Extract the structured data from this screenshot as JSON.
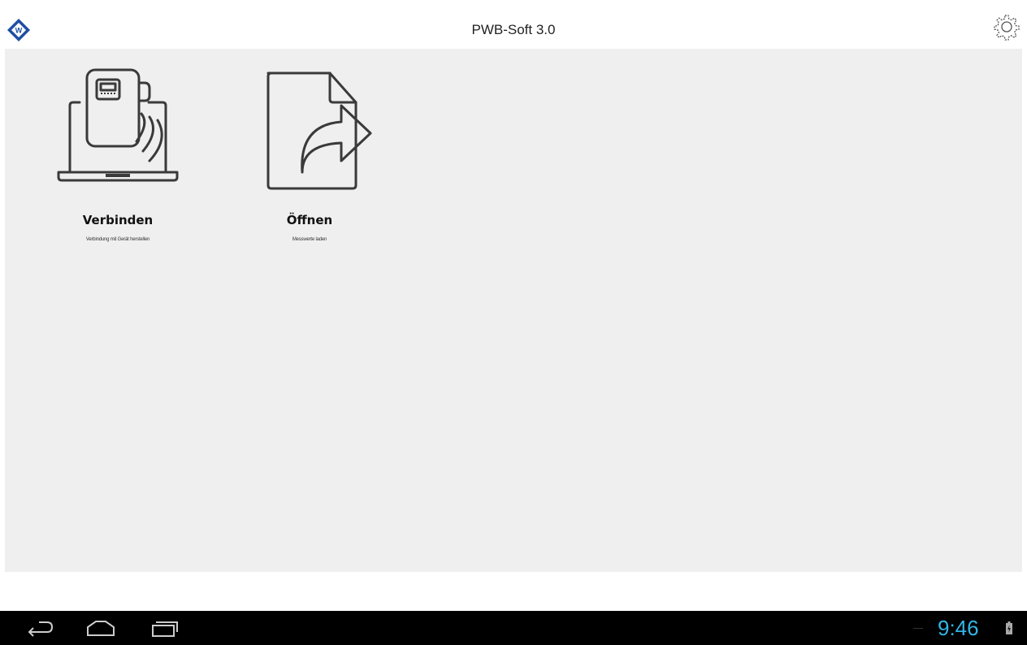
{
  "app": {
    "title": "PWB-Soft 3.0",
    "logo_icon": "pwb-diamond-logo-icon",
    "settings_icon": "gear-icon",
    "accent_color": "#1f4fa3"
  },
  "tiles": [
    {
      "label": "Verbinden",
      "subtitle": "Verbindung mit Gerät herstellen",
      "icon": "laptop-device-wireless-icon"
    },
    {
      "label": "Öffnen",
      "subtitle": "Messwerte laden",
      "icon": "file-share-arrow-icon"
    }
  ],
  "navbar": {
    "back_icon": "back-icon",
    "home_icon": "home-icon",
    "recent_icon": "recent-apps-icon",
    "clock": "9:46",
    "clock_color": "#33b5e5",
    "battery_icon": "battery-charging-icon"
  }
}
